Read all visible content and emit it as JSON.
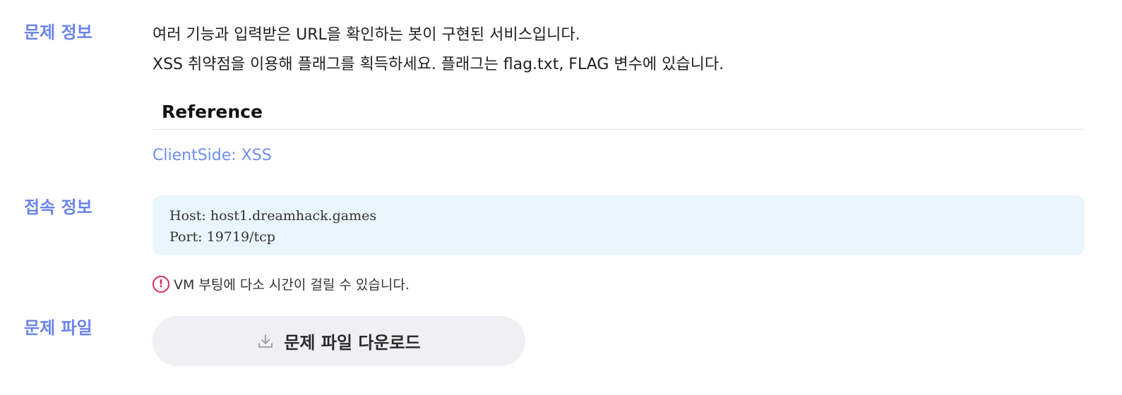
{
  "colors": {
    "accent": "#6b84ea",
    "link": "#6f8df0",
    "connection_bg": "#eaf6fd",
    "alert": "#e0245e"
  },
  "sections": {
    "description_label": "문제 정보",
    "connection_label": "접속 정보",
    "file_label": "문제 파일"
  },
  "description": {
    "line1": "여러 기능과 입력받은 URL을 확인하는 봇이 구현된 서비스입니다.",
    "line2": "XSS 취약점을 이용해 플래그를 획득하세요. 플래그는 flag.txt, FLAG 변수에 있습니다."
  },
  "reference": {
    "heading": "Reference",
    "link_text": "ClientSide: XSS"
  },
  "connection": {
    "host_line": "Host: host1.dreamhack.games",
    "port_line": "Port: 19719/tcp"
  },
  "notice": {
    "icon": "alert-circle-icon",
    "glyph": "!",
    "text": "VM 부팅에 다소 시간이 걸릴 수 있습니다."
  },
  "download": {
    "icon": "download-icon",
    "label": "문제 파일 다운로드"
  }
}
